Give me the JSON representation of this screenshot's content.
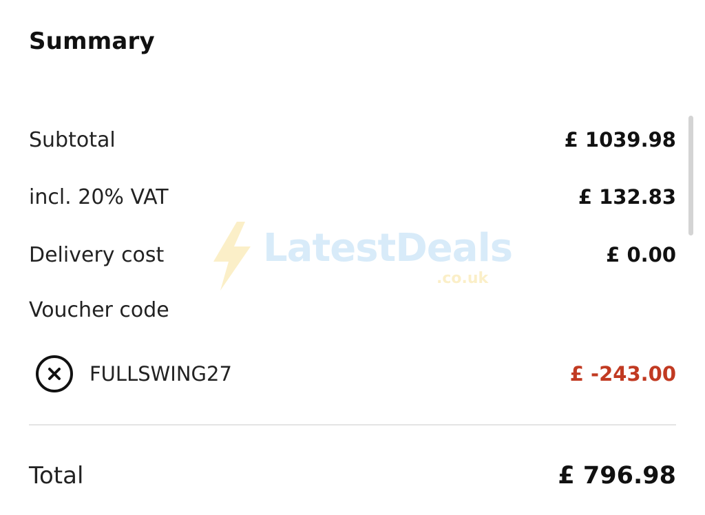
{
  "summary": {
    "title": "Summary",
    "subtotal": {
      "label": "Subtotal",
      "value": "£ 1039.98"
    },
    "vat": {
      "label": "incl. 20% VAT",
      "value": "£ 132.83"
    },
    "delivery": {
      "label": "Delivery cost",
      "value": "£ 0.00"
    },
    "voucher": {
      "heading": "Voucher code",
      "code": "FULLSWING27",
      "value": "£ -243.00",
      "remove_icon": "close-circle-icon"
    },
    "total": {
      "label": "Total",
      "value": "£ 796.98"
    }
  },
  "watermark": {
    "brand": "LatestDeals",
    "domain": ".co.uk",
    "icon": "lightning-bolt-icon"
  },
  "colors": {
    "text": "#111111",
    "discount": "#c13a22",
    "divider": "#e4e4e4",
    "watermark_blue": "#a9d3f2",
    "watermark_yellow": "#f7dc86"
  }
}
